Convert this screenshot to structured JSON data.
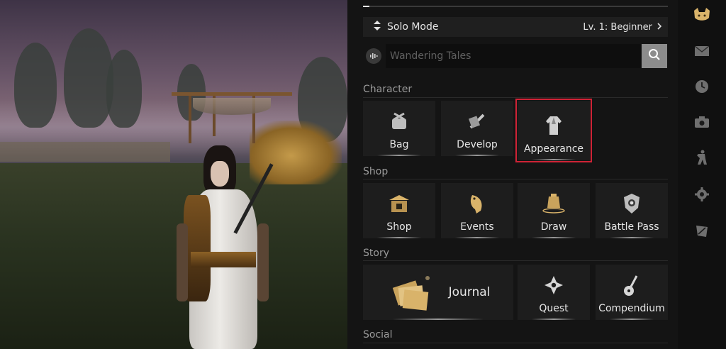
{
  "top_progress": {
    "value": 0.02
  },
  "mode_bar": {
    "mode_label": "Solo Mode",
    "level_label": "Lv. 1: Beginner",
    "chevron": "chevron-right-icon"
  },
  "search": {
    "placeholder": "Wandering Tales",
    "voice_icon": "voice-wave-icon",
    "search_icon": "search-icon"
  },
  "sections": {
    "character": {
      "title": "Character",
      "tiles": [
        {
          "label": "Bag",
          "icon": "bag-icon"
        },
        {
          "label": "Develop",
          "icon": "develop-icon"
        },
        {
          "label": "Appearance",
          "icon": "robe-icon",
          "selected": true
        }
      ]
    },
    "shop": {
      "title": "Shop",
      "tiles": [
        {
          "label": "Shop",
          "icon": "shop-icon"
        },
        {
          "label": "Events",
          "icon": "bird-icon"
        },
        {
          "label": "Draw",
          "icon": "bell-icon"
        },
        {
          "label": "Battle Pass",
          "icon": "shield-badge-icon"
        }
      ]
    },
    "story": {
      "title": "Story",
      "tiles": [
        {
          "label": "Journal",
          "icon": "journal-cards-icon"
        },
        {
          "label": "Quest",
          "icon": "quest-flower-icon"
        },
        {
          "label": "Compendium",
          "icon": "lute-icon"
        }
      ]
    },
    "social": {
      "title": "Social"
    }
  },
  "sidebar_icons": [
    "cat-icon",
    "mail-icon",
    "clock-icon",
    "camera-icon",
    "martial-pose-icon",
    "settings-gear-icon",
    "flag-icon"
  ],
  "colors": {
    "panel_bg": "#141414",
    "tile_bg": "#1d1d1d",
    "selected_outline": "#cf2336",
    "accent_gold": "#d9b36a"
  }
}
